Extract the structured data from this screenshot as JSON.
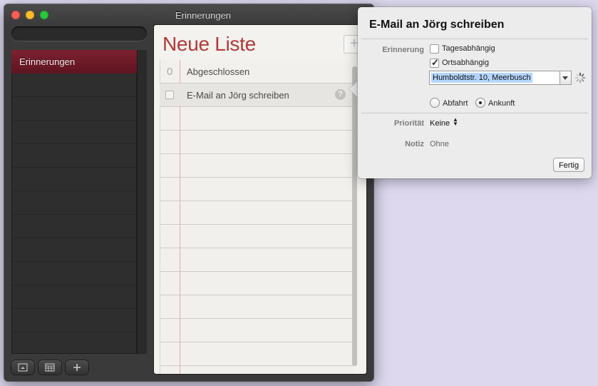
{
  "window": {
    "title": "Erinnerungen"
  },
  "sidebar": {
    "search_placeholder": "",
    "items": [
      {
        "label": "Erinnerungen",
        "selected": true
      }
    ],
    "buttons": [
      "show-calendar-icon",
      "calendar-grid-icon",
      "plus-icon"
    ]
  },
  "list": {
    "title": "Neue Liste",
    "add_label": "+",
    "completed_count": "0",
    "completed_label": "Abgeschlossen",
    "tasks": [
      {
        "label": "E-Mail an Jörg schreiben",
        "done": false
      }
    ]
  },
  "popover": {
    "title": "E-Mail an Jörg schreiben",
    "reminder_label": "Erinnerung",
    "on_day_label": "Tagesabhängig",
    "on_day_checked": false,
    "at_location_label": "Ortsabhängig",
    "at_location_checked": true,
    "location_value": "Humboldtstr. 10, Meerbusch",
    "leaving_label": "Abfahrt",
    "arriving_label": "Ankunft",
    "selected_trigger": "Ankunft",
    "priority_label": "Priorität",
    "priority_value": "Keine",
    "note_label": "Notiz",
    "note_value": "Ohne",
    "done_label": "Fertig"
  },
  "colors": {
    "desktop": "#ddd8ee",
    "accent_red": "#b23a3a",
    "sidebar_selected": "#6e1a28",
    "margin_line": "#e6a9ae"
  }
}
